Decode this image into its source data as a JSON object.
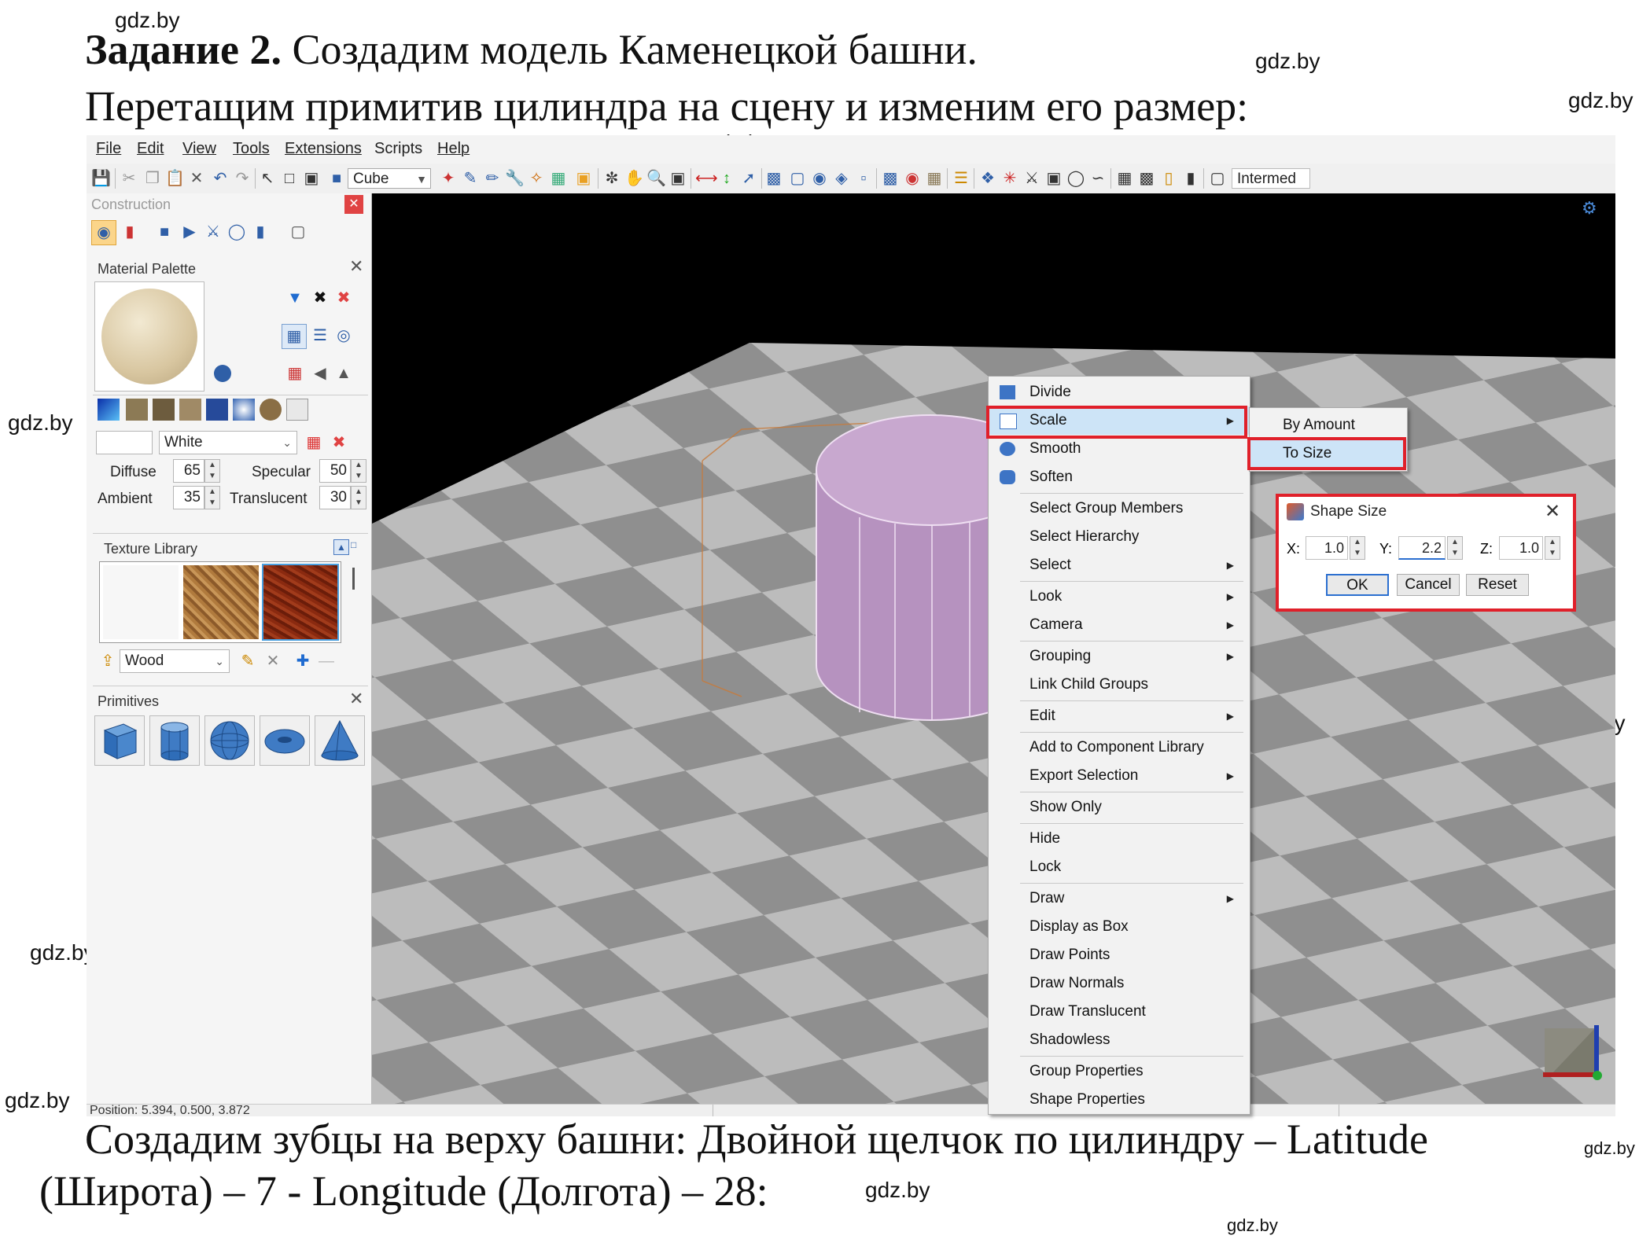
{
  "document": {
    "task_bold": "Задание 2.",
    "task_rest": " Создадим модель Каменецкой башни.",
    "line2": "Перетащим примитив цилиндра на сцену и изменим его размер:",
    "bottom_line1": "Создадим зубцы на верху башни: Двойной щелчок по цилиндру – Latitude",
    "bottom_line2": "(Широта) – 7 - Longitude (Долгота) – 28:"
  },
  "watermark": "gdz.by",
  "menubar": [
    "File",
    "Edit",
    "View",
    "Tools",
    "Extensions",
    "Scripts",
    "Help"
  ],
  "toolbar": {
    "shape_combo": "Cube",
    "mode_combo": "Intermed"
  },
  "panel": {
    "title": "Construction",
    "material_palette": "Material Palette",
    "material_name": "White",
    "diffuse_label": "Diffuse",
    "diffuse_value": "65",
    "specular_label": "Specular",
    "specular_value": "50",
    "ambient_label": "Ambient",
    "ambient_value": "35",
    "translucent_label": "Translucent",
    "translucent_value": "30",
    "texture_library": "Texture Library",
    "texture_category": "Wood",
    "primitives": "Primitives"
  },
  "status_text": "Position: 5.394, 0.500, 3.872",
  "context_menu": [
    {
      "label": "Divide",
      "sub": false
    },
    {
      "label": "Scale",
      "sub": true,
      "highlight": true
    },
    {
      "label": "Smooth",
      "sub": false
    },
    {
      "label": "Soften",
      "sub": false
    },
    {
      "label": "Select Group Members",
      "sub": false
    },
    {
      "label": "Select Hierarchy",
      "sub": false
    },
    {
      "label": "Select",
      "sub": true
    },
    {
      "label": "Look",
      "sub": true
    },
    {
      "label": "Camera",
      "sub": true
    },
    {
      "label": "Grouping",
      "sub": true
    },
    {
      "label": "Link Child Groups",
      "sub": false
    },
    {
      "label": "Edit",
      "sub": true
    },
    {
      "label": "Add to Component Library",
      "sub": false
    },
    {
      "label": "Export Selection",
      "sub": true
    },
    {
      "label": "Show Only",
      "sub": false
    },
    {
      "label": "Hide",
      "sub": false
    },
    {
      "label": "Lock",
      "sub": false
    },
    {
      "label": "Draw",
      "sub": true
    },
    {
      "label": "Display as Box",
      "sub": false
    },
    {
      "label": "Draw Points",
      "sub": false
    },
    {
      "label": "Draw Normals",
      "sub": false
    },
    {
      "label": "Draw Translucent",
      "sub": false
    },
    {
      "label": "Shadowless",
      "sub": false
    },
    {
      "label": "Group Properties",
      "sub": false
    },
    {
      "label": "Shape Properties",
      "sub": false
    }
  ],
  "submenu": {
    "by_amount": "By Amount",
    "to_size": "To Size"
  },
  "dialog": {
    "title": "Shape Size",
    "x_label": "X:",
    "x_value": "1.0",
    "y_label": "Y:",
    "y_value": "2.2",
    "z_label": "Z:",
    "z_value": "1.0",
    "ok": "OK",
    "cancel": "Cancel",
    "reset": "Reset"
  },
  "colors": {
    "highlight_box": "#e0202a",
    "menu_hover": "#cde4f7",
    "cylinder": "#c8a8cf"
  }
}
